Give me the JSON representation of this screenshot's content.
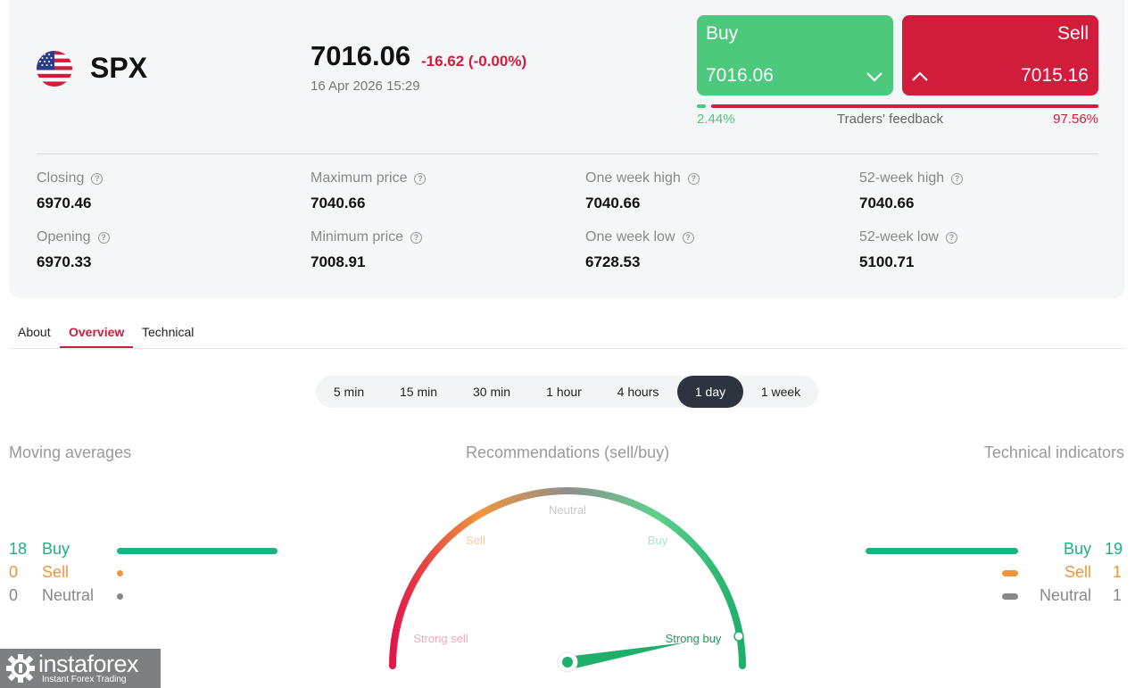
{
  "instrument": {
    "symbol": "SPX",
    "flag_icon": "us-flag-icon",
    "price": "7016.06",
    "change": "-16.62 (-0.00%)",
    "datetime": "16 Apr 2026 15:29"
  },
  "trade": {
    "buy_label": "Buy",
    "buy_price": "7016.06",
    "sell_label": "Sell",
    "sell_price": "7015.16",
    "feedback_label": "Traders' feedback",
    "buy_pct_text": "2.44%",
    "sell_pct_text": "97.56%",
    "buy_share": 0.0244,
    "sell_share": 0.9756
  },
  "stats": [
    {
      "label": "Closing",
      "value": "6970.46"
    },
    {
      "label": "Opening",
      "value": "6970.33"
    },
    {
      "label": "Maximum price",
      "value": "7040.66"
    },
    {
      "label": "Minimum price",
      "value": "7008.91"
    },
    {
      "label": "One week high",
      "value": "7040.66"
    },
    {
      "label": "One week low",
      "value": "6728.53"
    },
    {
      "label": "52-week high",
      "value": "7040.66"
    },
    {
      "label": "52-week low",
      "value": "5100.71"
    }
  ],
  "tabs": [
    {
      "label": "About"
    },
    {
      "label": "Overview",
      "active": true
    },
    {
      "label": "Technical"
    }
  ],
  "periods": [
    {
      "label": "5 min"
    },
    {
      "label": "15 min"
    },
    {
      "label": "30 min"
    },
    {
      "label": "1 hour"
    },
    {
      "label": "4 hours"
    },
    {
      "label": "1 day",
      "active": true
    },
    {
      "label": "1 week"
    }
  ],
  "moving_averages": {
    "title": "Moving averages",
    "rows": [
      {
        "name": "Buy",
        "count": "18"
      },
      {
        "name": "Sell",
        "count": "0"
      },
      {
        "name": "Neutral",
        "count": "0"
      }
    ]
  },
  "recommendations": {
    "title": "Recommendations (sell/buy)",
    "labels": {
      "strong_sell": "Strong sell",
      "sell": "Sell",
      "neutral": "Neutral",
      "buy": "Buy",
      "strong_buy": "Strong buy"
    },
    "active": "Strong buy"
  },
  "technical_indicators": {
    "title": "Technical indicators",
    "rows": [
      {
        "name": "Buy",
        "count": "19"
      },
      {
        "name": "Sell",
        "count": "1"
      },
      {
        "name": "Neutral",
        "count": "1"
      }
    ]
  },
  "colors": {
    "buy": "#4cc97d",
    "sell": "#d21c3c",
    "ma_buy": "#1eaf82",
    "ma_sell": "#f0953c",
    "neutral": "#888888"
  },
  "logo": {
    "name": "instaforex",
    "tagline": "Instant Forex Trading"
  }
}
